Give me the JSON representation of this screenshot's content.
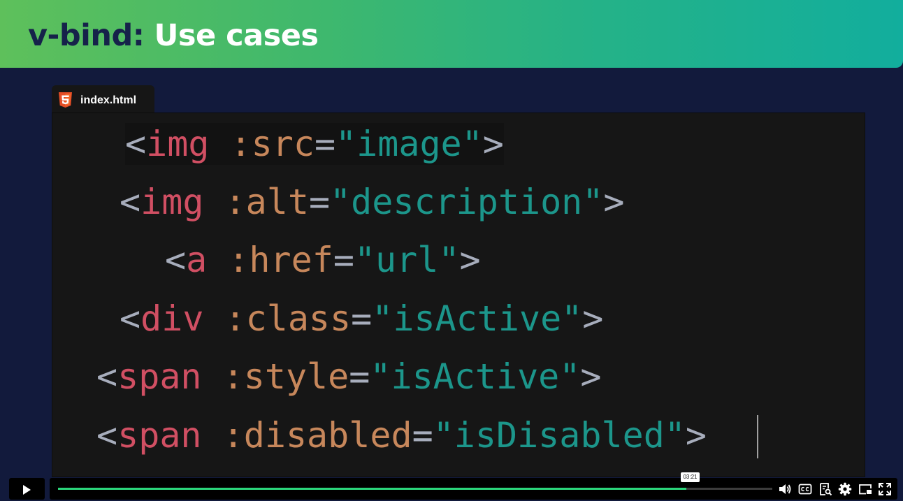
{
  "slide": {
    "title_keyword": "v-bind:",
    "title_rest": "Use cases"
  },
  "file_tab": {
    "icon": "html5-icon",
    "filename": "index.html"
  },
  "code_lines": [
    {
      "open": "<",
      "tag": "img",
      "attr": " :src",
      "eq": "=",
      "value": "\"image\"",
      "close": ">"
    },
    {
      "open": "<",
      "tag": "img",
      "attr": " :alt",
      "eq": "=",
      "value": "\"description\"",
      "close": ">"
    },
    {
      "open": "<",
      "tag": "a",
      "attr": " :href",
      "eq": "=",
      "value": "\"url\"",
      "close": ">"
    },
    {
      "open": "<",
      "tag": "div",
      "attr": " :class",
      "eq": "=",
      "value": "\"isActive\"",
      "close": ">"
    },
    {
      "open": "<",
      "tag": "span",
      "attr": " :style",
      "eq": "=",
      "value": "\"isActive\"",
      "close": ">"
    },
    {
      "open": "<",
      "tag": "span",
      "attr": " :disabled",
      "eq": "=",
      "value": "\"isDisabled\"",
      "close": ">"
    }
  ],
  "colors": {
    "background": "#121a3c",
    "banner_start": "#5ec05b",
    "banner_end": "#12ae9d",
    "code_tag": "#d14f63",
    "code_attr": "#c7875b",
    "code_string": "#1c968b",
    "code_punct": "#a7adbc",
    "progress": "#2bd67b"
  },
  "player": {
    "play_icon": "play-icon",
    "progress_fraction": 0.88,
    "timestamp": "03:21",
    "icons": [
      "volume-icon",
      "closed-captions-icon",
      "transcript-icon",
      "settings-gear-icon",
      "picture-in-picture-icon",
      "fullscreen-icon"
    ]
  }
}
